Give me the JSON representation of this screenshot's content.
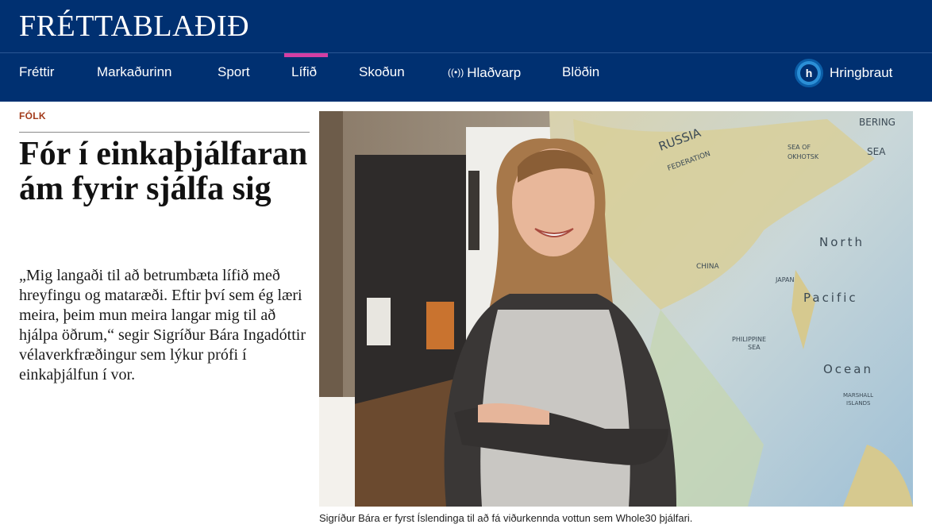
{
  "site": {
    "logo": "FRÉTTABLAÐIÐ"
  },
  "nav": {
    "items": [
      {
        "label": "Fréttir"
      },
      {
        "label": "Markaðurinn"
      },
      {
        "label": "Sport"
      },
      {
        "label": "Lífið",
        "active": true
      },
      {
        "label": "Skoðun"
      },
      {
        "label": "Hlaðvarp",
        "icon": "podcast-icon"
      },
      {
        "label": "Blöðin"
      }
    ],
    "hringbraut": {
      "label": "Hringbraut",
      "logo_letter": "h"
    }
  },
  "article": {
    "kicker": "FÓLK",
    "title": "Fór í einkaþjálfaranám fyrir sjálfa sig",
    "lead": "„Mig langaði til að betrumbæta lífið með hreyfingu og mataræði. Eftir því sem ég læri meira, þeim mun meira langar mig til að hjálpa öðrum,“ segir Sigríður Bára Ingadóttir vélaverkfræðingur sem lýkur prófi í einkaþjálfun í vor.",
    "photo": {
      "caption": "Sigríður Bára er fyrst Íslendinga til að fá viðurkennda vottun sem Whole30 þjálfari.",
      "map_labels": [
        "RUSSIA",
        "FEDERATION",
        "BERING",
        "SEA",
        "SEA OF",
        "OKHOTSK",
        "JAPAN",
        "CHINA",
        "North",
        "Pacific",
        "Ocean",
        "PHILIPPINE",
        "SEA",
        "MARSHALL",
        "ISLANDS"
      ]
    }
  },
  "colors": {
    "brand": "#003071",
    "accent": "#d33fa4",
    "kicker": "#a23a1a",
    "hringbraut_blue": "#2b8fd6"
  }
}
